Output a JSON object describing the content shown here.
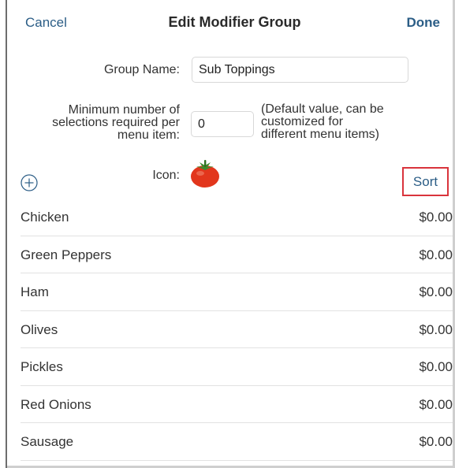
{
  "header": {
    "cancel_label": "Cancel",
    "title": "Edit Modifier Group",
    "done_label": "Done"
  },
  "form": {
    "group_name_label": "Group Name:",
    "group_name_value": "Sub Toppings",
    "min_label_line1": "Minimum number of",
    "min_label_line2": "selections required per",
    "min_label_line3": "menu item:",
    "min_value": "0",
    "min_help_line1": "(Default value, can be",
    "min_help_line2": "customized for",
    "min_help_line3": "different menu items)",
    "icon_label": "Icon:",
    "icon_name": "tomato-icon"
  },
  "toolbar": {
    "add_icon": "plus-circle-icon",
    "sort_label": "Sort"
  },
  "items": [
    {
      "name": "Chicken",
      "price": "$0.00"
    },
    {
      "name": "Green Peppers",
      "price": "$0.00"
    },
    {
      "name": "Ham",
      "price": "$0.00"
    },
    {
      "name": "Olives",
      "price": "$0.00"
    },
    {
      "name": "Pickles",
      "price": "$0.00"
    },
    {
      "name": "Red Onions",
      "price": "$0.00"
    },
    {
      "name": "Sausage",
      "price": "$0.00"
    }
  ],
  "colors": {
    "accent": "#2b5d86",
    "highlight": "#d9343c",
    "tomato": "#e2361c",
    "leaf": "#3e8a2a"
  }
}
